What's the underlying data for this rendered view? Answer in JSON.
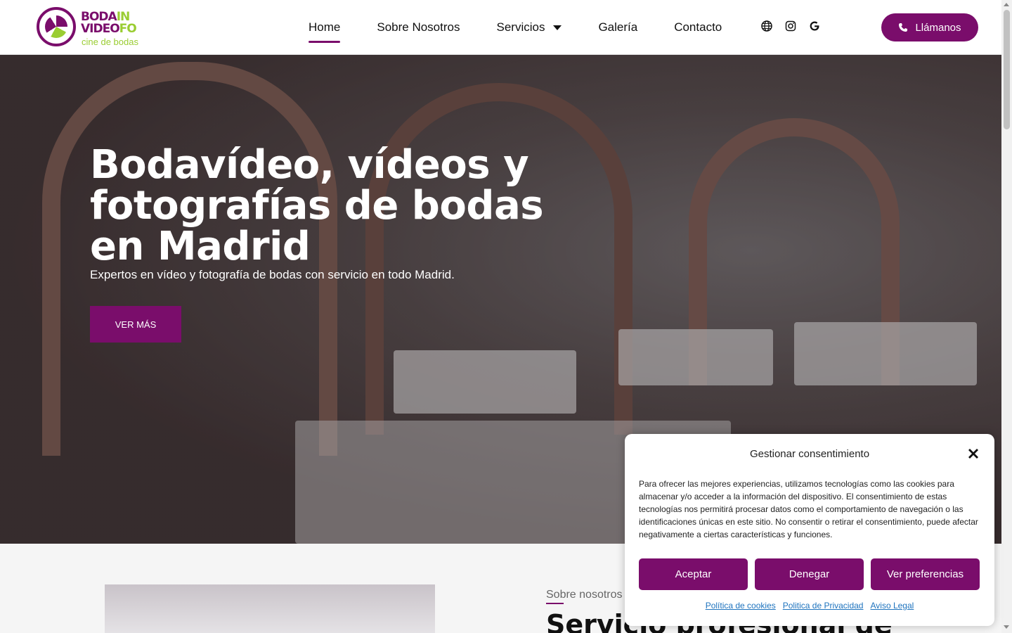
{
  "brand": {
    "logo_line1_a": "BODA",
    "logo_line1_b": "IN",
    "logo_line2_a": "VIDEO",
    "logo_line2_b": "FO",
    "logo_tagline": "cine de bodas",
    "primary_color": "#7a0d6b",
    "accent_color": "#9acd32"
  },
  "nav": {
    "items": [
      {
        "label": "Home",
        "active": true
      },
      {
        "label": "Sobre Nosotros"
      },
      {
        "label": "Servicios",
        "has_dropdown": true
      },
      {
        "label": "Galería"
      },
      {
        "label": "Contacto"
      }
    ],
    "social_icons": [
      "globe-icon",
      "instagram-icon",
      "google-icon"
    ],
    "call_label": "Llámanos"
  },
  "hero": {
    "title": "Bodavídeo, vídeos y fotografías de bodas en Madrid",
    "subtitle": "Expertos en vídeo y fotografía de bodas con servicio en todo Madrid.",
    "button_label": "VER MÁS"
  },
  "about": {
    "label": "Sobre nosotros",
    "heading": "Servicio profesional de"
  },
  "cookie": {
    "title": "Gestionar consentimiento",
    "text": "Para ofrecer las mejores experiencias, utilizamos tecnologías como las cookies para almacenar y/o acceder a la información del dispositivo. El consentimiento de estas tecnologías nos permitirá procesar datos como el comportamiento de navegación o las identificaciones únicas en este sitio. No consentir o retirar el consentimiento, puede afectar negativamente a ciertas características y funciones.",
    "accept_label": "Aceptar",
    "deny_label": "Denegar",
    "preferences_label": "Ver preferencias",
    "links": [
      "Política de cookies",
      "Politica de Privacidad",
      "Aviso Legal"
    ]
  }
}
